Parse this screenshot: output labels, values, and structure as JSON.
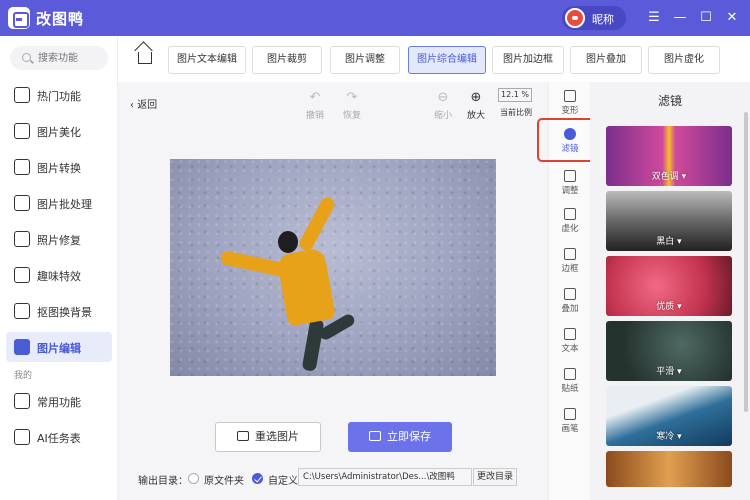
{
  "app": {
    "name": "改图鸭",
    "user_name": "昵称"
  },
  "window_controls": {
    "menu": "☰",
    "minimize": "—",
    "maximize": "☐",
    "close": "✕"
  },
  "search": {
    "placeholder": "搜索功能"
  },
  "sidebar": {
    "items": [
      {
        "label": "热门功能",
        "icon": "fire-icon"
      },
      {
        "label": "图片美化",
        "icon": "image-beautify-icon"
      },
      {
        "label": "图片转换",
        "icon": "image-convert-icon"
      },
      {
        "label": "图片批处理",
        "icon": "batch-icon"
      },
      {
        "label": "照片修复",
        "icon": "repair-icon"
      },
      {
        "label": "趣味特效",
        "icon": "effect-icon"
      },
      {
        "label": "抠图换背景",
        "icon": "cutout-icon"
      },
      {
        "label": "图片编辑",
        "icon": "image-edit-icon",
        "active": true
      }
    ],
    "section_label": "我的",
    "my_items": [
      {
        "label": "常用功能",
        "icon": "grid-icon"
      },
      {
        "label": "AI任务表",
        "icon": "ai-task-icon"
      }
    ]
  },
  "tabs": [
    "图片文本编辑",
    "图片裁剪",
    "图片调整",
    "图片综合编辑",
    "图片加边框",
    "图片叠加",
    "图片虚化"
  ],
  "active_tab": "图片综合编辑",
  "toolbar": {
    "back": "返回",
    "undo": "撤销",
    "redo": "恢复",
    "zoom_out": "缩小",
    "zoom_in": "放大",
    "zoom_value": "12.1 %",
    "current_ratio": "当前比例"
  },
  "actions": {
    "reselect": "重选图片",
    "save": "立即保存"
  },
  "output": {
    "label": "输出目录：",
    "option_original": "原文件夹",
    "option_custom": "自定义",
    "path": "C:\\Users\\Administrator\\Des...\\改图鸭",
    "change_dir": "更改目录"
  },
  "tool_strip": [
    {
      "label": "变形",
      "icon": "crop-icon"
    },
    {
      "label": "滤镜",
      "icon": "filter-icon",
      "active": true
    },
    {
      "label": "调整",
      "icon": "adjust-icon"
    },
    {
      "label": "虚化",
      "icon": "blur-icon"
    },
    {
      "label": "边框",
      "icon": "border-icon"
    },
    {
      "label": "叠加",
      "icon": "overlay-icon"
    },
    {
      "label": "文本",
      "icon": "text-icon"
    },
    {
      "label": "贴纸",
      "icon": "sticker-icon"
    },
    {
      "label": "画笔",
      "icon": "brush-icon"
    }
  ],
  "filter_panel": {
    "title": "滤镜",
    "filters": [
      {
        "label": "双色调 ▾",
        "color": "#b04a9a"
      },
      {
        "label": "黑白 ▾",
        "color": "#555555"
      },
      {
        "label": "优质 ▾",
        "color": "#e0566a"
      },
      {
        "label": "平滑 ▾",
        "color": "#2f3f3c"
      },
      {
        "label": "寒冷 ▾",
        "color": "#2a5d8a"
      },
      {
        "label": "",
        "color": "#c9782c"
      }
    ]
  },
  "colors": {
    "accent": "#5b5bd9",
    "save_button": "#6c72ea",
    "highlight": "#d9432f"
  }
}
